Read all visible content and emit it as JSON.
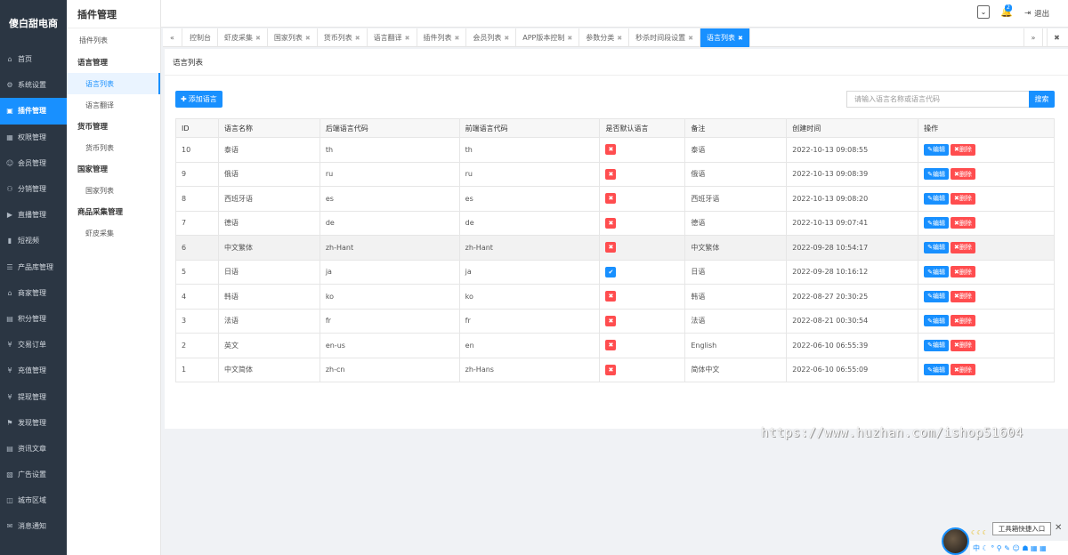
{
  "brand": "傻白甜电商",
  "sidebar": {
    "items": [
      {
        "label": "首页",
        "icon": "⌂"
      },
      {
        "label": "系统设置",
        "icon": "⚙"
      },
      {
        "label": "插件管理",
        "icon": "▣",
        "active": true
      },
      {
        "label": "权限管理",
        "icon": "▦"
      },
      {
        "label": "会员管理",
        "icon": "☺"
      },
      {
        "label": "分销管理",
        "icon": "⚇"
      },
      {
        "label": "直播管理",
        "icon": "▶"
      },
      {
        "label": "短视频",
        "icon": "▮"
      },
      {
        "label": "产品库管理",
        "icon": "☰"
      },
      {
        "label": "商家管理",
        "icon": "⌂"
      },
      {
        "label": "积分管理",
        "icon": "▤"
      },
      {
        "label": "交易订单",
        "icon": "¥"
      },
      {
        "label": "充值管理",
        "icon": "¥"
      },
      {
        "label": "提现管理",
        "icon": "¥"
      },
      {
        "label": "发现管理",
        "icon": "⚑"
      },
      {
        "label": "资讯文章",
        "icon": "▤"
      },
      {
        "label": "广告设置",
        "icon": "▧"
      },
      {
        "label": "城市区域",
        "icon": "◫"
      },
      {
        "label": "消息通知",
        "icon": "✉"
      }
    ]
  },
  "submenu": {
    "title": "插件管理",
    "top_item": "插件列表",
    "groups": [
      {
        "label": "语言管理",
        "items": [
          "语言列表",
          "语言翻译"
        ]
      },
      {
        "label": "货币管理",
        "items": [
          "货币列表"
        ]
      },
      {
        "label": "国家管理",
        "items": [
          "国家列表"
        ]
      },
      {
        "label": "商品采集管理",
        "items": [
          "虾皮采集"
        ]
      }
    ],
    "active_item": "语言列表"
  },
  "topbar": {
    "select_glyph": "⌄",
    "notification_count": "2",
    "logout_label": "退出",
    "logout_icon": "⇥"
  },
  "tabs": {
    "prev_glyph": "«",
    "next_glyph": "»",
    "close_all_glyph": "✖",
    "items": [
      {
        "label": "控制台",
        "closable": false
      },
      {
        "label": "虾皮采集",
        "closable": true
      },
      {
        "label": "国家列表",
        "closable": true
      },
      {
        "label": "货币列表",
        "closable": true
      },
      {
        "label": "语言翻译",
        "closable": true
      },
      {
        "label": "插件列表",
        "closable": true
      },
      {
        "label": "会员列表",
        "closable": true
      },
      {
        "label": "APP版本控制",
        "closable": true
      },
      {
        "label": "参数分类",
        "closable": true
      },
      {
        "label": "秒杀时间段设置",
        "closable": true
      },
      {
        "label": "语言列表",
        "closable": true,
        "active": true
      }
    ]
  },
  "panel": {
    "title": "语言列表",
    "add_button": "添加语言",
    "search_placeholder": "请输入语言名称或语言代码",
    "search_button": "搜索"
  },
  "table": {
    "columns": [
      "ID",
      "语言名称",
      "后端语言代码",
      "前端语言代码",
      "是否默认语言",
      "备注",
      "创建时间",
      "操作"
    ],
    "edit_label": "编辑",
    "delete_label": "删除",
    "rows": [
      {
        "id": "10",
        "name": "泰语",
        "backend": "th",
        "frontend": "th",
        "default": false,
        "note": "泰语",
        "created": "2022-10-13 09:08:55"
      },
      {
        "id": "9",
        "name": "俄语",
        "backend": "ru",
        "frontend": "ru",
        "default": false,
        "note": "俄语",
        "created": "2022-10-13 09:08:39"
      },
      {
        "id": "8",
        "name": "西班牙语",
        "backend": "es",
        "frontend": "es",
        "default": false,
        "note": "西班牙语",
        "created": "2022-10-13 09:08:20"
      },
      {
        "id": "7",
        "name": "德语",
        "backend": "de",
        "frontend": "de",
        "default": false,
        "note": "德语",
        "created": "2022-10-13 09:07:41"
      },
      {
        "id": "6",
        "name": "中文繁体",
        "backend": "zh-Hant",
        "frontend": "zh-Hant",
        "default": false,
        "note": "中文繁体",
        "created": "2022-09-28 10:54:17",
        "highlight": true
      },
      {
        "id": "5",
        "name": "日语",
        "backend": "ja",
        "frontend": "ja",
        "default": true,
        "note": "日语",
        "created": "2022-09-28 10:16:12"
      },
      {
        "id": "4",
        "name": "韩语",
        "backend": "ko",
        "frontend": "ko",
        "default": false,
        "note": "韩语",
        "created": "2022-08-27 20:30:25"
      },
      {
        "id": "3",
        "name": "法语",
        "backend": "fr",
        "frontend": "fr",
        "default": false,
        "note": "法语",
        "created": "2022-08-21 00:30:54"
      },
      {
        "id": "2",
        "name": "英文",
        "backend": "en-us",
        "frontend": "en",
        "default": false,
        "note": "English",
        "created": "2022-06-10 06:55:39"
      },
      {
        "id": "1",
        "name": "中文简体",
        "backend": "zh-cn",
        "frontend": "zh-Hans",
        "default": false,
        "note": "简体中文",
        "created": "2022-06-10 06:55:09"
      }
    ]
  },
  "watermark": "https://www.huzhan.com/ishop51604",
  "toolbox": {
    "label": "工具箱快捷入口",
    "close_glyph": "✕",
    "bar_glyphs": "中 ☾ ° ⚲ ✎ ☺ ☗ ▦ ▦"
  },
  "colors": {
    "accent": "#1890ff",
    "danger": "#ff4d4f",
    "sidebar_bg": "#2b3643"
  }
}
